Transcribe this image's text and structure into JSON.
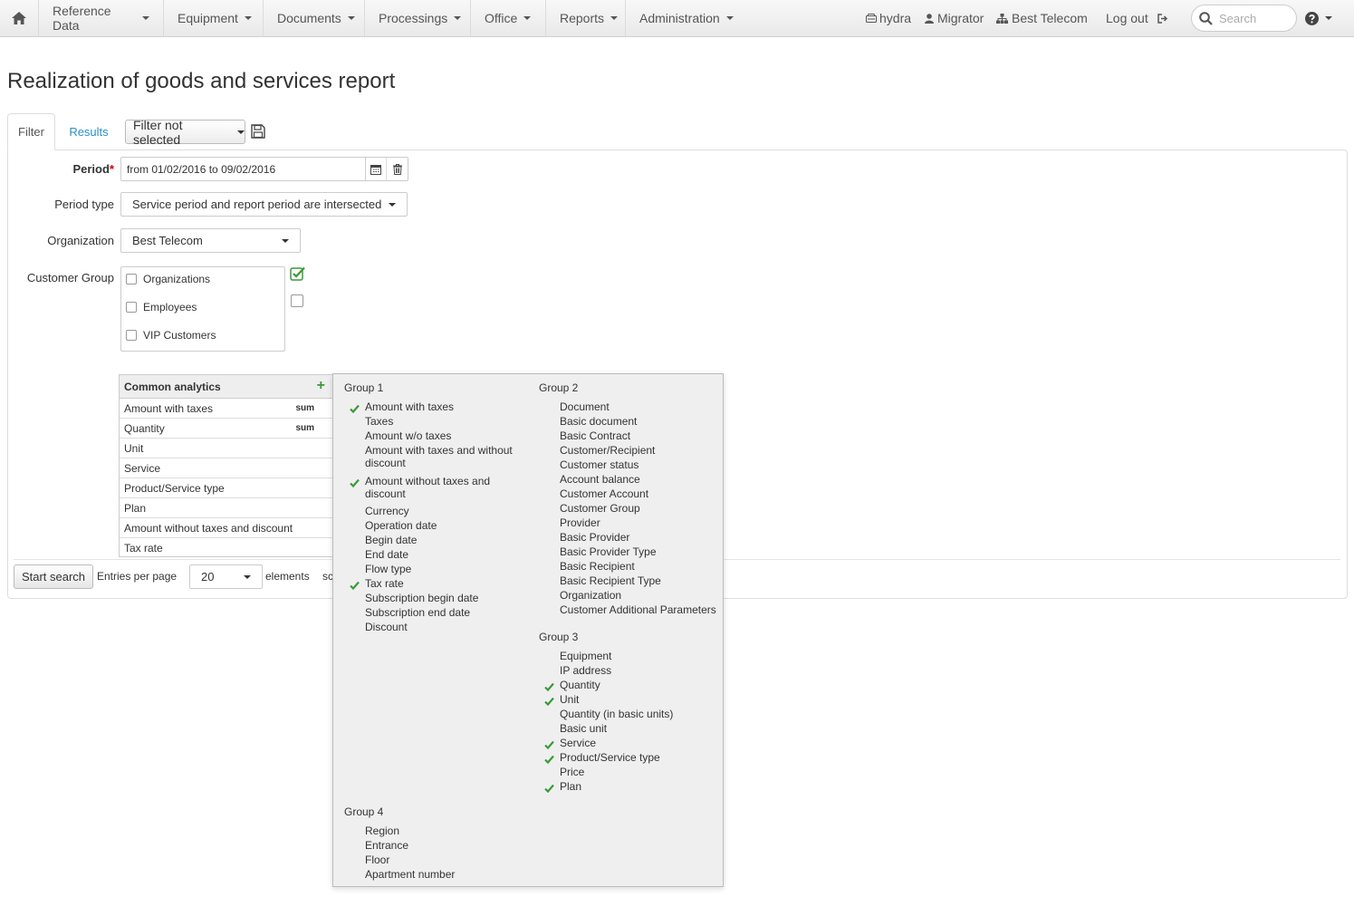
{
  "nav": {
    "menu": [
      {
        "label": "Reference Data"
      },
      {
        "label": "Equipment"
      },
      {
        "label": "Documents"
      },
      {
        "label": "Processings"
      },
      {
        "label": "Office"
      },
      {
        "label": "Reports"
      },
      {
        "label": "Administration"
      }
    ],
    "server": "hydra",
    "user": "Migrator",
    "company": "Best Telecom",
    "logout": "Log out",
    "search_placeholder": "Search"
  },
  "page": {
    "title": "Realization of goods and services report"
  },
  "tabs": {
    "filter": "Filter",
    "results": "Results",
    "filter_select": "Filter not selected"
  },
  "form": {
    "period_label": "Period",
    "period_required": "*",
    "period_value": "from 01/02/2016 to 09/02/2016",
    "period_type_label": "Period type",
    "period_type_value": "Service period and report period are intersected",
    "organization_label": "Organization",
    "organization_value": "Best Telecom",
    "customer_group_label": "Customer Group",
    "customer_groups": [
      {
        "label": "Organizations",
        "checked": false
      },
      {
        "label": "Employees",
        "checked": false
      },
      {
        "label": "VIP Customers",
        "checked": false
      }
    ]
  },
  "analytics": {
    "title": "Common analytics",
    "rows": [
      {
        "label": "Amount with taxes",
        "agg": "sum"
      },
      {
        "label": "Quantity",
        "agg": "sum"
      },
      {
        "label": "Unit",
        "agg": ""
      },
      {
        "label": "Service",
        "agg": ""
      },
      {
        "label": "Product/Service type",
        "agg": ""
      },
      {
        "label": "Plan",
        "agg": ""
      },
      {
        "label": "Amount without taxes and discount",
        "agg": ""
      },
      {
        "label": "Tax rate",
        "agg": ""
      }
    ]
  },
  "footer": {
    "start_search": "Start search",
    "entries_label": "Entries per page",
    "entries_value": "20",
    "elements_label": "elements",
    "trailing": "sc"
  },
  "popup": {
    "group1": {
      "title": "Group 1",
      "items": [
        {
          "label": "Amount with taxes",
          "checked": true
        },
        {
          "label": "Taxes",
          "checked": false
        },
        {
          "label": "Amount w/o taxes",
          "checked": false
        },
        {
          "label": "Amount with taxes and without discount",
          "checked": false
        },
        {
          "label": "Amount without taxes and discount",
          "checked": true
        },
        {
          "label": "Currency",
          "checked": false
        },
        {
          "label": "Operation date",
          "checked": false
        },
        {
          "label": "Begin date",
          "checked": false
        },
        {
          "label": "End date",
          "checked": false
        },
        {
          "label": "Flow type",
          "checked": false
        },
        {
          "label": "Tax rate",
          "checked": true
        },
        {
          "label": "Subscription begin date",
          "checked": false
        },
        {
          "label": "Subscription end date",
          "checked": false
        },
        {
          "label": "Discount",
          "checked": false
        }
      ]
    },
    "group2": {
      "title": "Group 2",
      "items": [
        {
          "label": "Document",
          "checked": false
        },
        {
          "label": "Basic document",
          "checked": false
        },
        {
          "label": "Basic Contract",
          "checked": false
        },
        {
          "label": "Customer/Recipient",
          "checked": false
        },
        {
          "label": "Customer status",
          "checked": false
        },
        {
          "label": "Account balance",
          "checked": false
        },
        {
          "label": "Customer Account",
          "checked": false
        },
        {
          "label": "Customer Group",
          "checked": false
        },
        {
          "label": "Provider",
          "checked": false
        },
        {
          "label": "Basic Provider",
          "checked": false
        },
        {
          "label": "Basic Provider Type",
          "checked": false
        },
        {
          "label": "Basic Recipient",
          "checked": false
        },
        {
          "label": "Basic Recipient Type",
          "checked": false
        },
        {
          "label": "Organization",
          "checked": false
        },
        {
          "label": "Customer Additional Parameters",
          "checked": false
        }
      ]
    },
    "group3": {
      "title": "Group 3",
      "items": [
        {
          "label": "Equipment",
          "checked": false
        },
        {
          "label": "IP address",
          "checked": false
        },
        {
          "label": "Quantity",
          "checked": true
        },
        {
          "label": "Unit",
          "checked": true
        },
        {
          "label": "Quantity (in basic units)",
          "checked": false
        },
        {
          "label": "Basic unit",
          "checked": false
        },
        {
          "label": "Service",
          "checked": true
        },
        {
          "label": "Product/Service type",
          "checked": true
        },
        {
          "label": "Price",
          "checked": false
        },
        {
          "label": "Plan",
          "checked": true
        }
      ]
    },
    "group4": {
      "title": "Group 4",
      "items": [
        {
          "label": "Region",
          "checked": false
        },
        {
          "label": "Entrance",
          "checked": false
        },
        {
          "label": "Floor",
          "checked": false
        },
        {
          "label": "Apartment number",
          "checked": false
        }
      ]
    }
  },
  "colors": {
    "accent_link": "#2a8fc8",
    "check_green": "#3a9a3a",
    "required_red": "#cc0000"
  }
}
